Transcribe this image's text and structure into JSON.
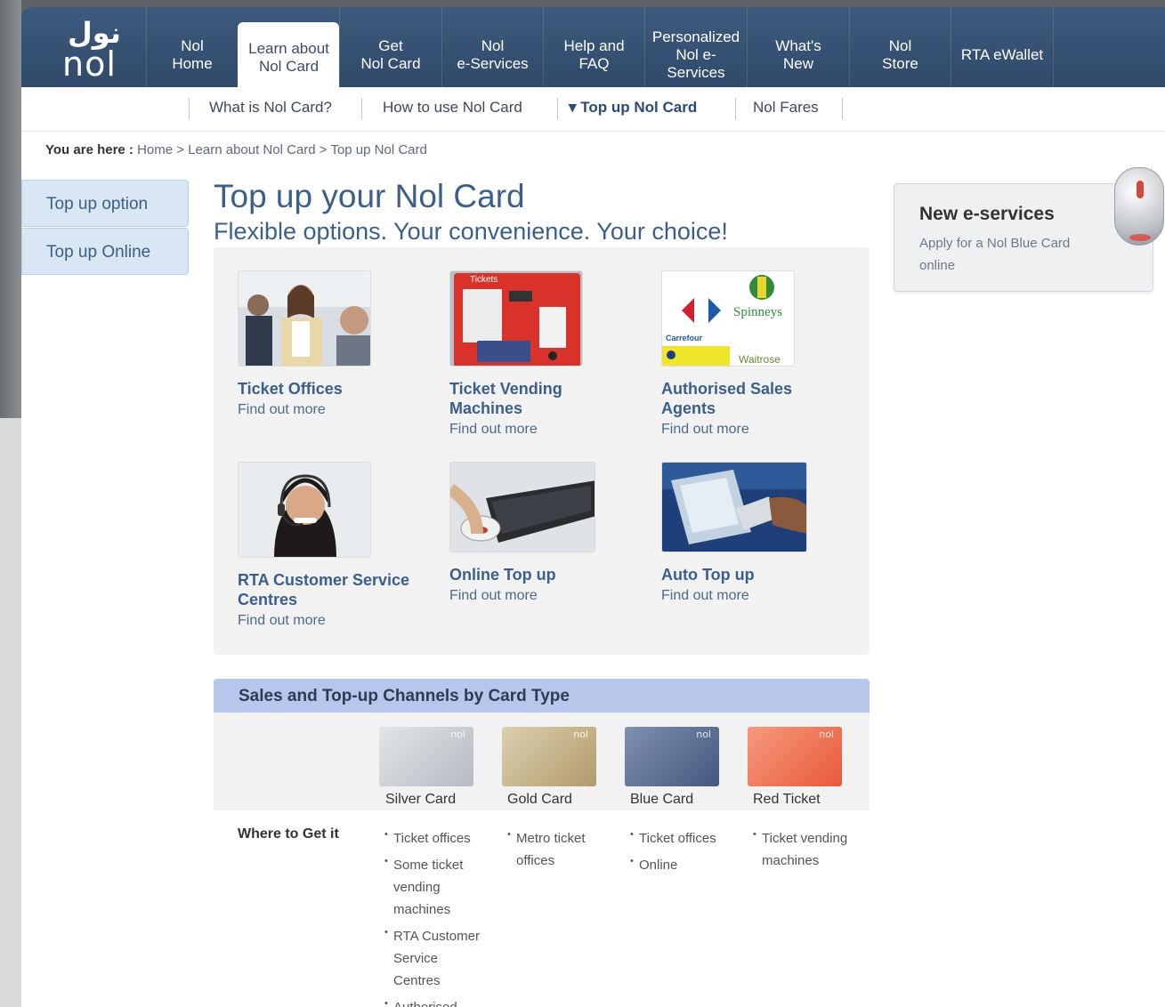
{
  "logo": {
    "arabic": "نول",
    "english": "nol"
  },
  "nav": {
    "items": [
      {
        "label": "Nol\nHome"
      },
      {
        "label": "Learn about\nNol Card",
        "active": true
      },
      {
        "label": "Get\nNol Card"
      },
      {
        "label": "Nol\ne-Services"
      },
      {
        "label": "Help and\nFAQ"
      },
      {
        "label": "Personalized\nNol e-Services"
      },
      {
        "label": "What's\nNew"
      },
      {
        "label": "Nol\nStore"
      },
      {
        "label": "RTA eWallet"
      }
    ]
  },
  "subnav": {
    "items": [
      "What is Nol Card?",
      "How to use Nol Card",
      "▾  Top up Nol Card",
      "Nol Fares"
    ]
  },
  "breadcrumb": {
    "prefix": "You are here :",
    "path": "Home >  Learn about Nol Card >  Top up Nol Card"
  },
  "sidemenu": {
    "items": [
      "Top up option",
      "Top up Online"
    ]
  },
  "main": {
    "title": "Top up your Nol Card",
    "subtitle": "Flexible options. Your convenience. Your choice!",
    "tiles": [
      {
        "title": "Ticket Offices",
        "link": "Find out more"
      },
      {
        "title": "Ticket Vending\nMachines",
        "link": "Find out more"
      },
      {
        "title": "Authorised Sales\nAgents",
        "link": "Find out more"
      },
      {
        "title": "RTA Customer Service\nCentres",
        "link": "Find out more"
      },
      {
        "title": "Online Top up",
        "link": "Find out more"
      },
      {
        "title": "Auto Top up",
        "link": "Find out more"
      }
    ],
    "tvm_label": "Tickets",
    "agents": {
      "carrefour": "Carrefour",
      "spinneys": "Spinneys",
      "waitrose": "Waitrose"
    }
  },
  "sales": {
    "heading": "Sales and Top-up Channels by Card Type",
    "cards": [
      {
        "name": "Silver Card",
        "color": "#c9cdd2"
      },
      {
        "name": "Gold Card",
        "color": "#c8b48a"
      },
      {
        "name": "Blue Card",
        "color": "#5a6f96"
      },
      {
        "name": "Red Ticket",
        "color": "#ef6b4c"
      }
    ],
    "where_label": "Where to Get it",
    "where": [
      [
        "Ticket offices",
        "Some ticket vending machines",
        "RTA Customer Service Centres",
        "Authorised"
      ],
      [
        "Metro ticket offices"
      ],
      [
        "Ticket offices",
        "Online"
      ],
      [
        "Ticket vending machines"
      ]
    ]
  },
  "eservices": {
    "title": "New e-services",
    "desc": "Apply for a Nol Blue Card online"
  }
}
